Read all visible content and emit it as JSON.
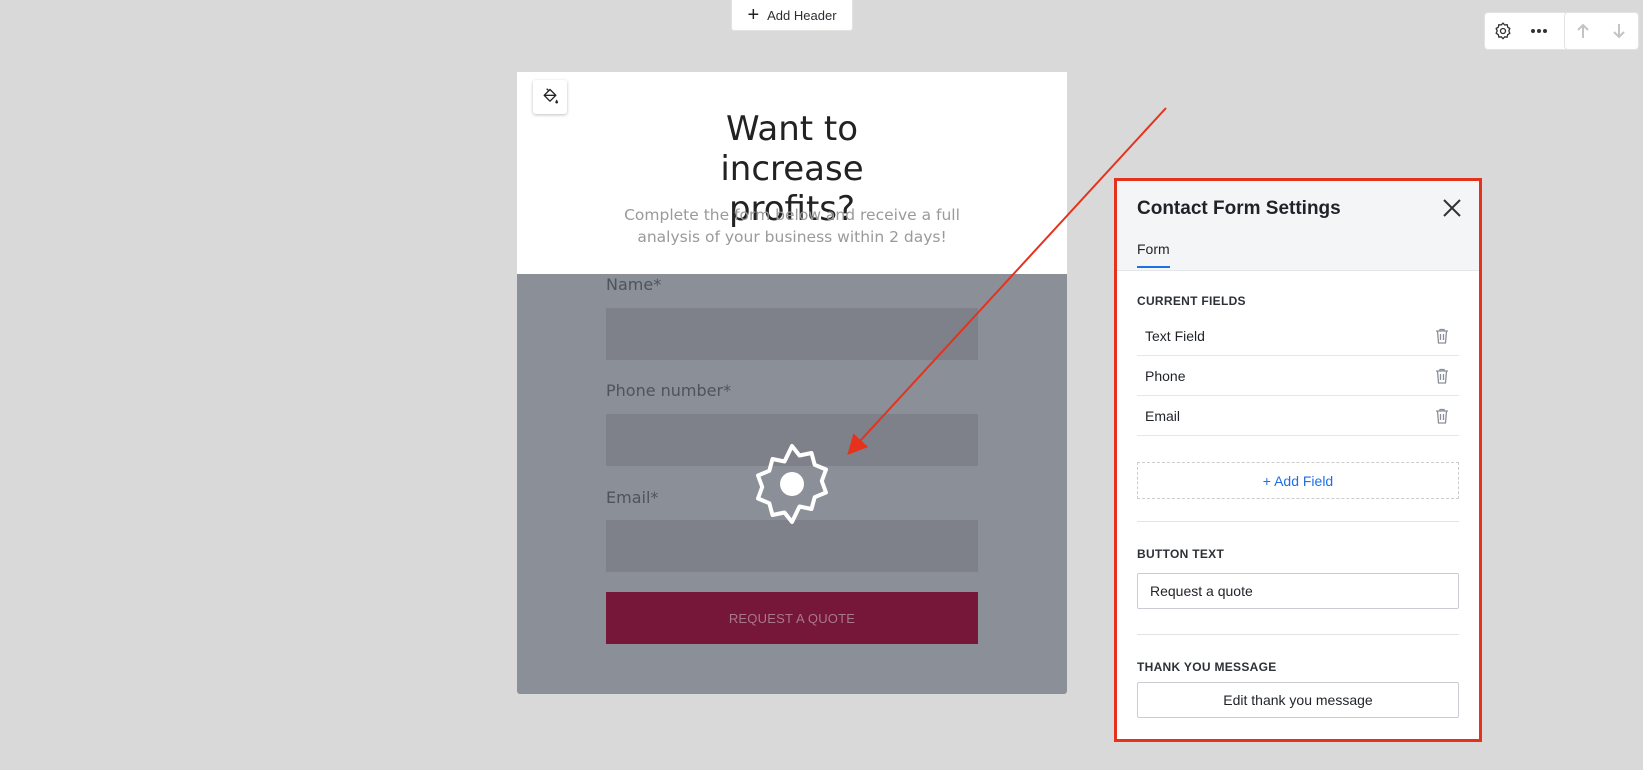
{
  "toolbar": {
    "add_header_label": "Add Header"
  },
  "form_section": {
    "headline": "Want to increase profits?",
    "subheadline": "Complete the form below and receive a full analysis of your business within 2 days!",
    "fields": [
      {
        "label": "Name*"
      },
      {
        "label": "Phone number*"
      },
      {
        "label": "Email*"
      }
    ],
    "submit_label": "REQUEST A QUOTE"
  },
  "panel": {
    "title": "Contact Form Settings",
    "tab": "Form",
    "current_fields_title": "CURRENT FIELDS",
    "current_fields": [
      {
        "name": "Text Field"
      },
      {
        "name": "Phone"
      },
      {
        "name": "Email"
      }
    ],
    "add_field_label": "+ Add Field",
    "button_text_title": "BUTTON TEXT",
    "button_text_value": "Request a quote",
    "thank_you_title": "THANK YOU MESSAGE",
    "thank_you_button": "Edit thank you message"
  },
  "colors": {
    "accent_blue": "#1f6fe5",
    "highlight_red": "#e5321d",
    "submit_bg": "#761638",
    "overlay_gray": "#8b8f97"
  },
  "icons": [
    "plus-icon",
    "gear-icon",
    "more-icon",
    "arrow-up-icon",
    "arrow-down-icon",
    "paint-bucket-icon",
    "close-icon",
    "trash-icon"
  ]
}
